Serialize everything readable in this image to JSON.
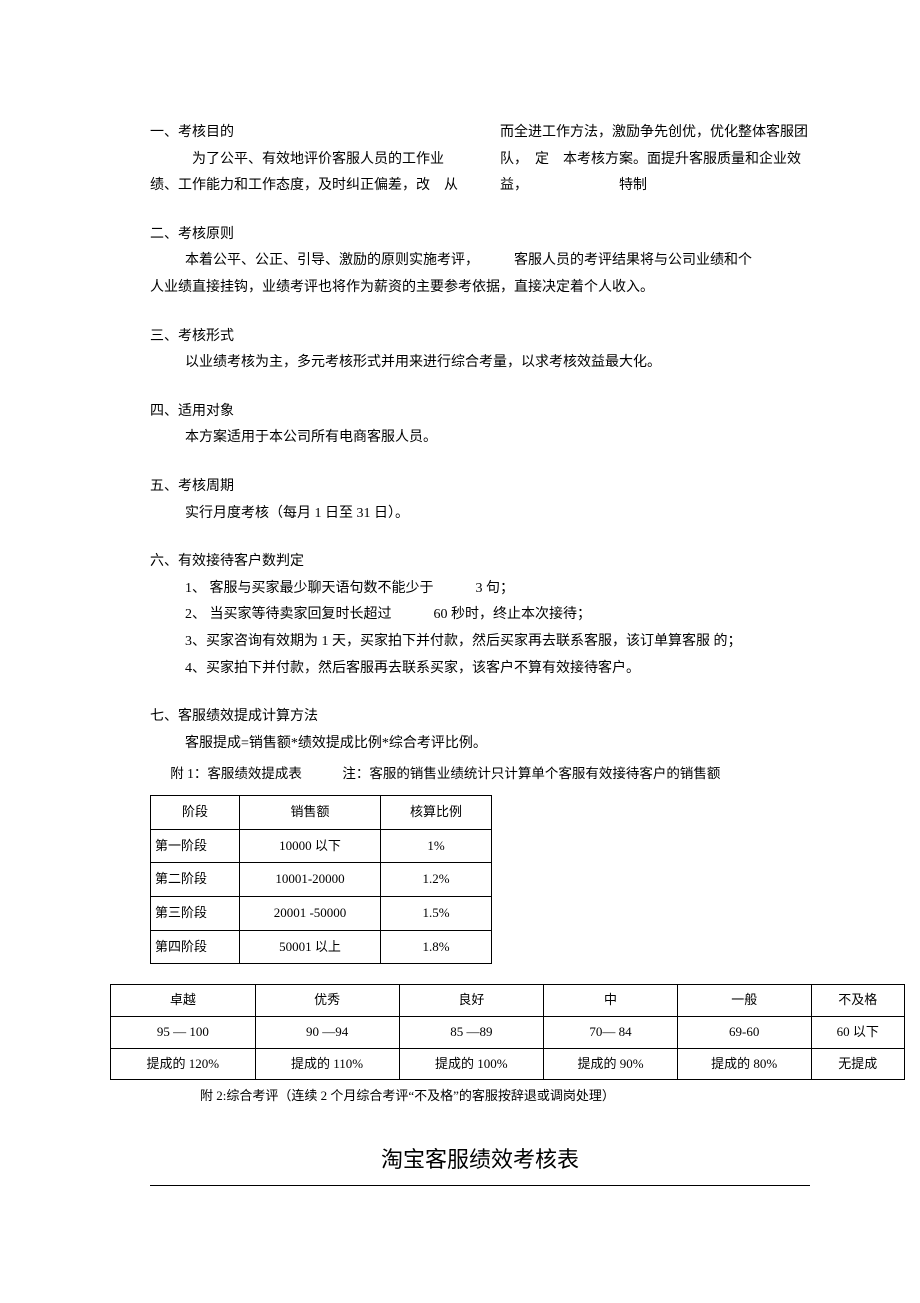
{
  "sec1": {
    "heading": "一、考核目的",
    "flow": "　　　为了公平、有效地评价客服人员的工作业绩、工作能力和工作态度，及时纠正偏差，改　从而全进工作方法，激励争先创优，优化整体客服团队，　定　本考核方案。面提升客服质量和企业效益，　　　　　　　特制"
  },
  "sec2": {
    "heading": "二、考核原则",
    "p1": "本着公平、公正、引导、激励的原则实施考评，　　　客服人员的考评结果将与公司业绩和个",
    "p2": "人业绩直接挂钩，业绩考评也将作为薪资的主要参考依据，直接决定着个人收入。"
  },
  "sec3": {
    "heading": "三、考核形式",
    "p1": "以业绩考核为主，多元考核形式并用来进行综合考量，以求考核效益最大化。"
  },
  "sec4": {
    "heading": "四、适用对象",
    "p1": "本方案适用于本公司所有电商客服人员。"
  },
  "sec5": {
    "heading": "五、考核周期",
    "p1": "实行月度考核（每月 1 日至 31 日）。"
  },
  "sec6": {
    "heading": "六、有效接待客户数判定",
    "i1": "1、 客服与买家最少聊天语句数不能少于　　　3 句；",
    "i2": "2、 当买家等待卖家回复时长超过　　　60 秒时，终止本次接待；",
    "i3": "3、买家咨询有效期为 1 天，买家拍下并付款，然后买家再去联系客服，该订单算客服 的；",
    "i4": "4、买家拍下并付款，然后客服再去联系买家，该客户不算有效接待客户。"
  },
  "sec7": {
    "heading": "七、客服绩效提成计算方法",
    "p1": "客服提成=销售额*绩效提成比例*综合考评比例。",
    "att1": "附 1：客服绩效提成表　　　注：客服的销售业绩统计只计算单个客服有效接待客户的销售额"
  },
  "table1": {
    "headers": [
      "阶段",
      "销售额",
      "核算比例"
    ],
    "rows": [
      [
        "第一阶段",
        "10000 以下",
        "1%"
      ],
      [
        "第二阶段",
        "10001-20000",
        "1.2%"
      ],
      [
        "第三阶段",
        "20001 -50000",
        "1.5%"
      ],
      [
        "第四阶段",
        "50001 以上",
        "1.8%"
      ]
    ]
  },
  "table2": {
    "row1": [
      "卓越",
      "优秀",
      "良好",
      "中",
      "一般",
      "不及格"
    ],
    "row2": [
      "95 — 100",
      "90 —94",
      "85 —89",
      "70— 84",
      "69-60",
      "60 以下"
    ],
    "row3": [
      "提成的 120%",
      "提成的 110%",
      "提成的 100%",
      "提成的 90%",
      "提成的 80%",
      "无提成"
    ]
  },
  "att2": "附 2:综合考评（连续 2 个月综合考评“不及格”的客服按辞退或调岗处理）",
  "bigtitle": "淘宝客服绩效考核表"
}
